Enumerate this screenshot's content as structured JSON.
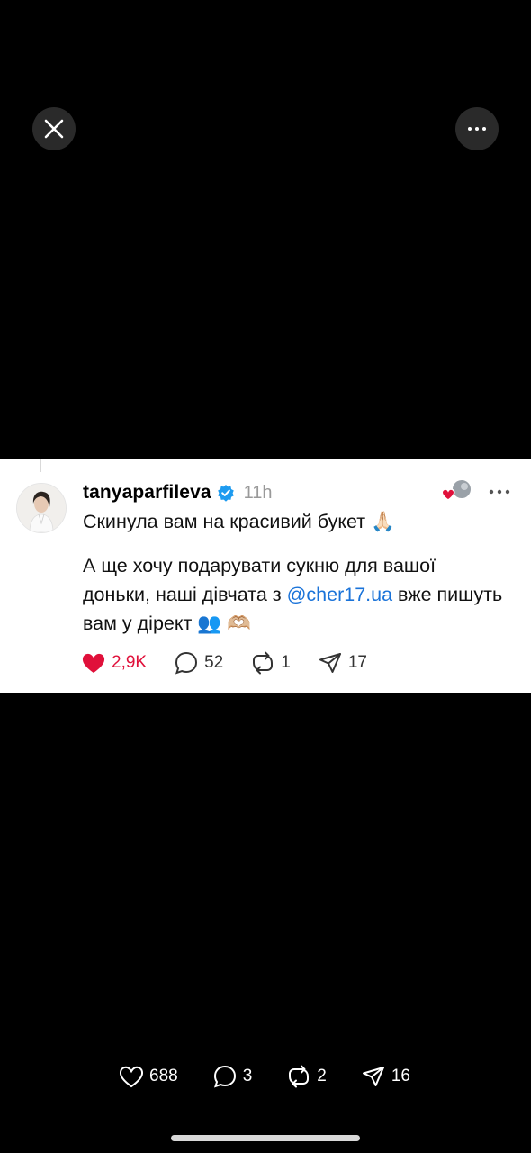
{
  "viewer": {
    "close_icon": "close-icon",
    "more_icon": "more-horizontal-icon"
  },
  "post": {
    "username": "tanyaparfileva",
    "verified": true,
    "time": "11h",
    "text_line1": "Скинула вам на красивий букет",
    "text_line1_emoji": "🙏🏻",
    "text_para2_start": "А ще хочу подарувати сукню для вашої доньки, наші дівчата з ",
    "mention": "@cher17.ua",
    "text_para2_end": " вже пишуть вам у дірект",
    "text_para2_emoji": "👥 🫶🏼",
    "likes": "2,9K",
    "comments": "52",
    "reposts": "1",
    "shares": "17",
    "liked": true
  },
  "footer_stats": {
    "likes": "688",
    "comments": "3",
    "reposts": "2",
    "shares": "16"
  },
  "colors": {
    "like_red": "#e0103a",
    "mention_blue": "#1a73d9",
    "verified_blue": "#1d9bf0"
  }
}
